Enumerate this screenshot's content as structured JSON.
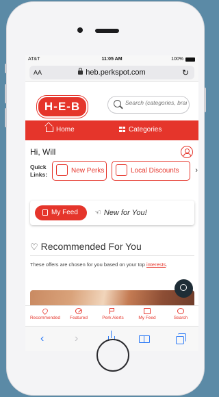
{
  "status_bar": {
    "carrier": "AT&T",
    "time": "11:05 AM",
    "battery": "100%"
  },
  "browser": {
    "text_size": "AA",
    "url": "heb.perkspot.com"
  },
  "header": {
    "logo_text": "H-E-B",
    "search_placeholder": "Search (categories, brands...)"
  },
  "nav": {
    "home": "Home",
    "categories": "Categories"
  },
  "greeting": "Hi, Will",
  "quick_links": {
    "label_line1": "Quick",
    "label_line2": "Links:",
    "items": [
      {
        "label": "New Perks"
      },
      {
        "label": "Local Discounts"
      }
    ]
  },
  "feed_toggle": {
    "my_feed": "My Feed",
    "new_for_you": "New for You!"
  },
  "recommended": {
    "title": "Recommended For You",
    "description": "These offers are chosen for you based on your top",
    "link": "interests",
    "link_suffix": "."
  },
  "bottom_tabs": [
    {
      "label": "Recommended",
      "icon": "heart-icon"
    },
    {
      "label": "Featured",
      "icon": "featured-icon"
    },
    {
      "label": "Perk Alerts",
      "icon": "flag-icon"
    },
    {
      "label": "My Feed",
      "icon": "feed-icon"
    },
    {
      "label": "Search",
      "icon": "search-icon"
    }
  ],
  "colors": {
    "brand": "#e5352b",
    "safari_blue": "#2f7cf6",
    "background": "#5b8aa6"
  }
}
